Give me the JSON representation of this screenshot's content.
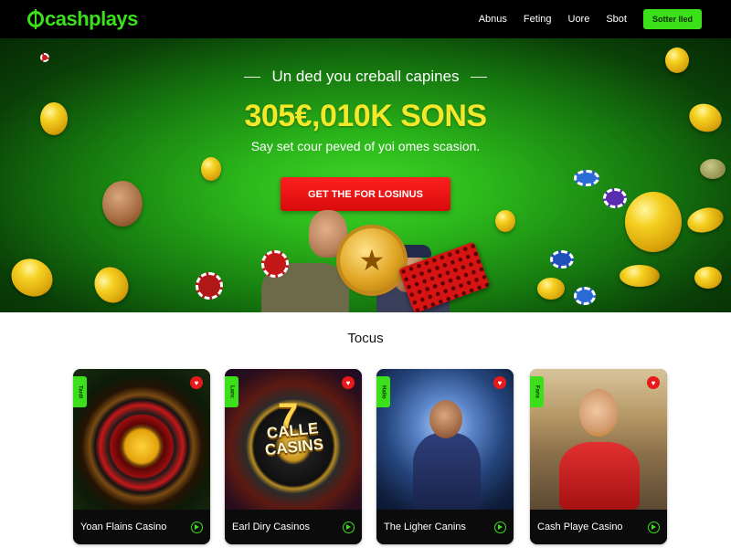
{
  "header": {
    "logo_text": "cashplays",
    "nav": [
      "Abnus",
      "Feting",
      "Uore",
      "Sbot"
    ],
    "cta_label": "Sotter lled"
  },
  "hero": {
    "tagline": "Un ded you creball capines",
    "headline": "305€,010K SONS",
    "subline": "Say set cour peved of yoi omes scasion.",
    "cta_label": "GET THE FOR LOSINUS"
  },
  "section": {
    "title": "Tocus"
  },
  "games": [
    {
      "name": "Yoan Flains Casino",
      "tag": "Tardi",
      "icon": "roulette-wheel"
    },
    {
      "name": "Earl Diry Casinos",
      "tag": "Lanc",
      "icon": "casino-logo"
    },
    {
      "name": "The Ligher Canins",
      "tag": "Hallo",
      "icon": "warrior"
    },
    {
      "name": "Cash Playe Casino",
      "tag": "Fans",
      "icon": "queen"
    }
  ],
  "colors": {
    "brand_green": "#3be01a",
    "cta_red": "#e01212",
    "headline_yellow": "#f4e82a"
  }
}
